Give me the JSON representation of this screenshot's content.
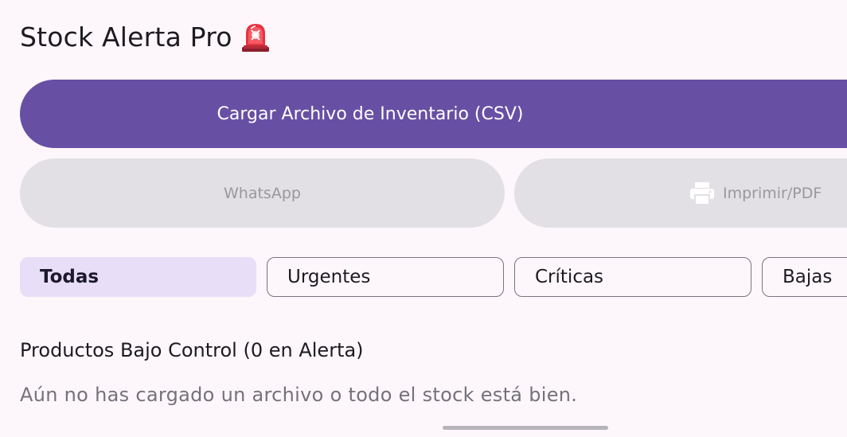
{
  "app": {
    "title": "Stock Alerta Pro",
    "title_icon": "police-siren-icon"
  },
  "actions": {
    "upload_label": "Cargar Archivo de Inventario (CSV)",
    "whatsapp_label": "WhatsApp",
    "print_label": "Imprimir/PDF",
    "print_icon": "printer-icon"
  },
  "filters": [
    {
      "label": "Todas",
      "selected": true
    },
    {
      "label": "Urgentes",
      "selected": false
    },
    {
      "label": "Críticas",
      "selected": false
    },
    {
      "label": "Bajas",
      "selected": false
    }
  ],
  "products": {
    "heading": "Productos Bajo Control (0 en Alerta)",
    "empty_message": "Aún no has cargado un archivo o todo el stock está bien."
  },
  "colors": {
    "primary": "#6750a4",
    "background": "#fdf7fc",
    "disabled_button": "#e3e0e5",
    "selected_chip": "#e8def8"
  }
}
